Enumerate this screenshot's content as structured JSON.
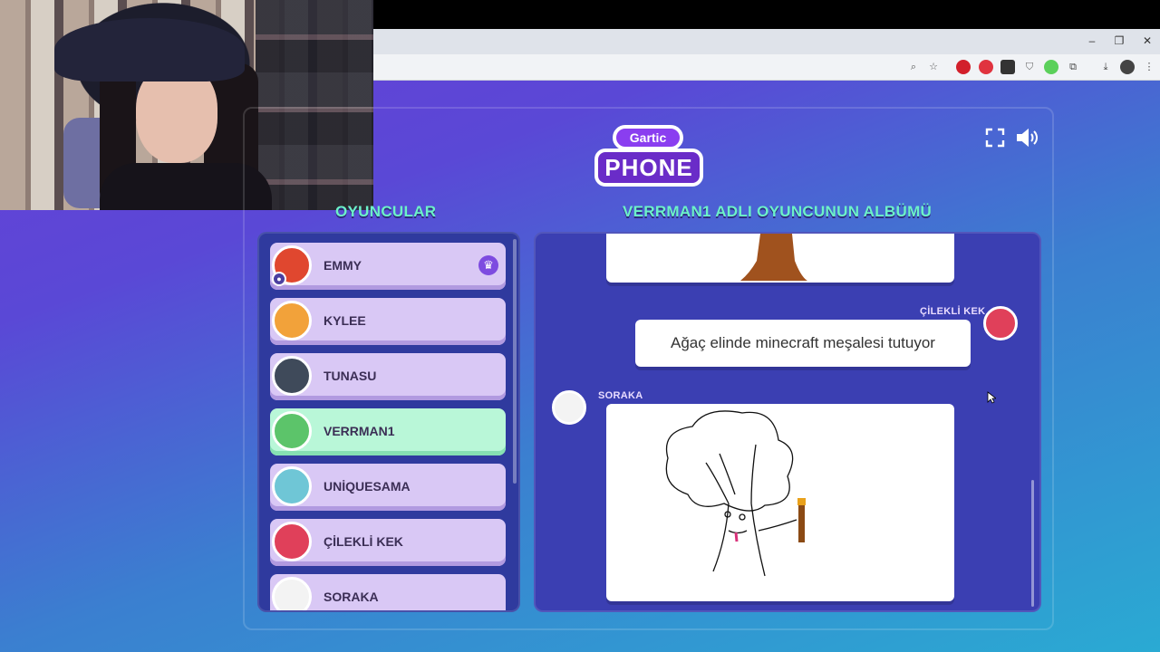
{
  "browser": {
    "window_controls": [
      "–",
      "❐",
      "✕"
    ],
    "toolbar_icons": [
      "zoom-icon",
      "star-icon",
      "opera-icon",
      "red-extension-icon",
      "extension-icon",
      "shield-icon",
      "green-extension-icon",
      "puzzle-icon",
      "download-icon",
      "profile-icon",
      "menu-icon"
    ]
  },
  "game": {
    "logo_top": "Gartic",
    "logo_bottom": "PHONE",
    "players_title": "OYUNCULAR",
    "album_title": "VERRMAN1 ADLI OYUNCUNUN ALBÜMÜ",
    "players": [
      {
        "name": "EMMY",
        "host": true,
        "avatar_color": "#e0472f"
      },
      {
        "name": "KYLEE",
        "avatar_color": "#f2a23a"
      },
      {
        "name": "TUNASU",
        "avatar_color": "#3f4a5a"
      },
      {
        "name": "VERRMAN1",
        "me": true,
        "avatar_color": "#5cc46a"
      },
      {
        "name": "UNİQUESAMA",
        "avatar_color": "#6fc6d6"
      },
      {
        "name": "ÇİLEKLİ KEK",
        "avatar_color": "#e0405a"
      },
      {
        "name": "SORAKA",
        "avatar_color": "#f3f3f3"
      }
    ],
    "album": {
      "guess_author": "ÇİLEKLİ KEK",
      "guess_text": "Ağaç elinde minecraft meşalesi tutuyor",
      "drawing_author": "SORAKA"
    }
  },
  "colors": {
    "accent_title": "#6cf2c8",
    "player_card": "#d9c8f5",
    "player_me": "#b9f7d8"
  }
}
